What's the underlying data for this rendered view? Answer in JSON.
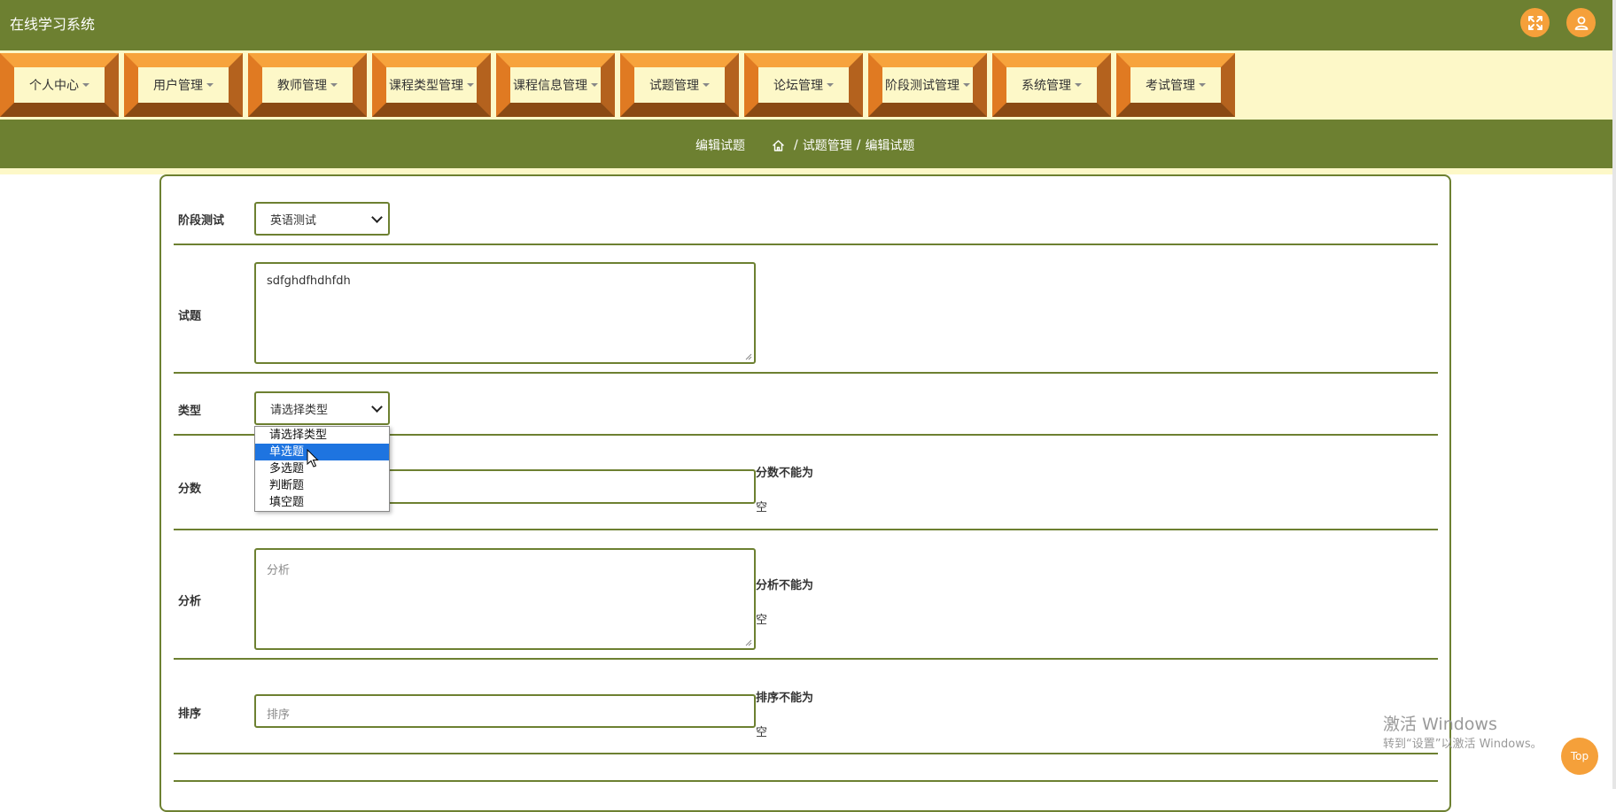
{
  "header": {
    "title": "在线学习系统"
  },
  "nav": {
    "items": [
      "个人中心",
      "用户管理",
      "教师管理",
      "课程类型管理",
      "课程信息管理",
      "试题管理",
      "论坛管理",
      "阶段测试管理",
      "系统管理",
      "考试管理"
    ]
  },
  "breadcrumb": {
    "page_title": "编辑试题",
    "crumbs": [
      "试题管理",
      "编辑试题"
    ]
  },
  "form": {
    "stage_test": {
      "label": "阶段测试",
      "value": "英语测试"
    },
    "question": {
      "label": "试题",
      "value": "sdfghdfhdhfdh"
    },
    "type": {
      "label": "类型",
      "value": "请选择类型",
      "options": [
        "请选择类型",
        "单选题",
        "多选题",
        "判断题",
        "填空题"
      ],
      "highlighted": "单选题"
    },
    "score": {
      "label": "分数",
      "error_line1": "分数不能为",
      "error_line2": "空"
    },
    "analysis": {
      "label": "分析",
      "placeholder": "分析",
      "error_line1": "分析不能为",
      "error_line2": "空"
    },
    "order": {
      "label": "排序",
      "placeholder": "排序",
      "error_line1": "排序不能为",
      "error_line2": "空"
    }
  },
  "watermark": {
    "line1": "激活 Windows",
    "line2": "转到“设置”以激活 Windows。"
  },
  "top_button": {
    "label": "Top"
  },
  "colors": {
    "primary": "#6d8031",
    "accent": "#f5a03a",
    "nav_bg": "#fdf8c8",
    "selected": "#1e74e0"
  }
}
